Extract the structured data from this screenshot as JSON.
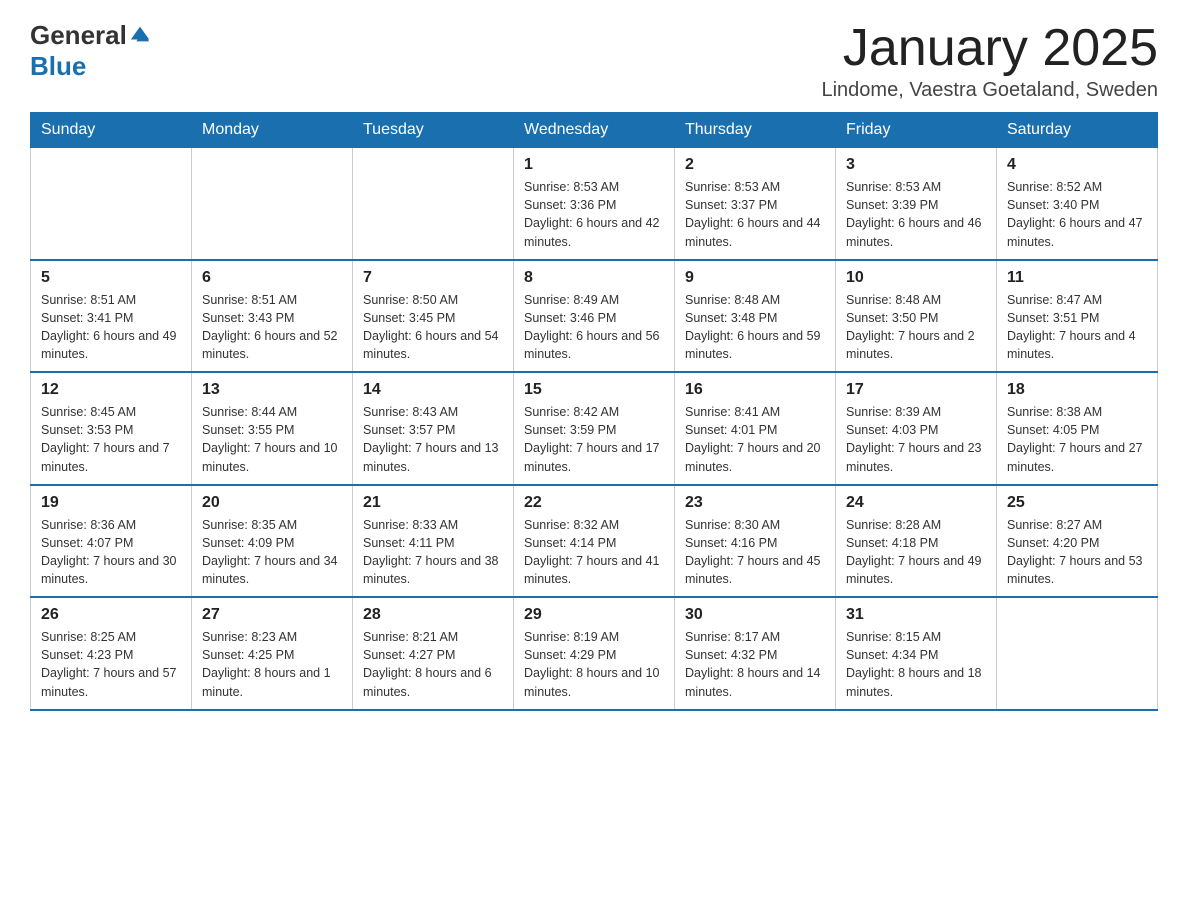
{
  "header": {
    "logo": {
      "general": "General",
      "blue": "Blue"
    },
    "title": "January 2025",
    "location": "Lindome, Vaestra Goetaland, Sweden"
  },
  "days_of_week": [
    "Sunday",
    "Monday",
    "Tuesday",
    "Wednesday",
    "Thursday",
    "Friday",
    "Saturday"
  ],
  "weeks": [
    [
      {
        "day": "",
        "info": ""
      },
      {
        "day": "",
        "info": ""
      },
      {
        "day": "",
        "info": ""
      },
      {
        "day": "1",
        "info": "Sunrise: 8:53 AM\nSunset: 3:36 PM\nDaylight: 6 hours and 42 minutes."
      },
      {
        "day": "2",
        "info": "Sunrise: 8:53 AM\nSunset: 3:37 PM\nDaylight: 6 hours and 44 minutes."
      },
      {
        "day": "3",
        "info": "Sunrise: 8:53 AM\nSunset: 3:39 PM\nDaylight: 6 hours and 46 minutes."
      },
      {
        "day": "4",
        "info": "Sunrise: 8:52 AM\nSunset: 3:40 PM\nDaylight: 6 hours and 47 minutes."
      }
    ],
    [
      {
        "day": "5",
        "info": "Sunrise: 8:51 AM\nSunset: 3:41 PM\nDaylight: 6 hours and 49 minutes."
      },
      {
        "day": "6",
        "info": "Sunrise: 8:51 AM\nSunset: 3:43 PM\nDaylight: 6 hours and 52 minutes."
      },
      {
        "day": "7",
        "info": "Sunrise: 8:50 AM\nSunset: 3:45 PM\nDaylight: 6 hours and 54 minutes."
      },
      {
        "day": "8",
        "info": "Sunrise: 8:49 AM\nSunset: 3:46 PM\nDaylight: 6 hours and 56 minutes."
      },
      {
        "day": "9",
        "info": "Sunrise: 8:48 AM\nSunset: 3:48 PM\nDaylight: 6 hours and 59 minutes."
      },
      {
        "day": "10",
        "info": "Sunrise: 8:48 AM\nSunset: 3:50 PM\nDaylight: 7 hours and 2 minutes."
      },
      {
        "day": "11",
        "info": "Sunrise: 8:47 AM\nSunset: 3:51 PM\nDaylight: 7 hours and 4 minutes."
      }
    ],
    [
      {
        "day": "12",
        "info": "Sunrise: 8:45 AM\nSunset: 3:53 PM\nDaylight: 7 hours and 7 minutes."
      },
      {
        "day": "13",
        "info": "Sunrise: 8:44 AM\nSunset: 3:55 PM\nDaylight: 7 hours and 10 minutes."
      },
      {
        "day": "14",
        "info": "Sunrise: 8:43 AM\nSunset: 3:57 PM\nDaylight: 7 hours and 13 minutes."
      },
      {
        "day": "15",
        "info": "Sunrise: 8:42 AM\nSunset: 3:59 PM\nDaylight: 7 hours and 17 minutes."
      },
      {
        "day": "16",
        "info": "Sunrise: 8:41 AM\nSunset: 4:01 PM\nDaylight: 7 hours and 20 minutes."
      },
      {
        "day": "17",
        "info": "Sunrise: 8:39 AM\nSunset: 4:03 PM\nDaylight: 7 hours and 23 minutes."
      },
      {
        "day": "18",
        "info": "Sunrise: 8:38 AM\nSunset: 4:05 PM\nDaylight: 7 hours and 27 minutes."
      }
    ],
    [
      {
        "day": "19",
        "info": "Sunrise: 8:36 AM\nSunset: 4:07 PM\nDaylight: 7 hours and 30 minutes."
      },
      {
        "day": "20",
        "info": "Sunrise: 8:35 AM\nSunset: 4:09 PM\nDaylight: 7 hours and 34 minutes."
      },
      {
        "day": "21",
        "info": "Sunrise: 8:33 AM\nSunset: 4:11 PM\nDaylight: 7 hours and 38 minutes."
      },
      {
        "day": "22",
        "info": "Sunrise: 8:32 AM\nSunset: 4:14 PM\nDaylight: 7 hours and 41 minutes."
      },
      {
        "day": "23",
        "info": "Sunrise: 8:30 AM\nSunset: 4:16 PM\nDaylight: 7 hours and 45 minutes."
      },
      {
        "day": "24",
        "info": "Sunrise: 8:28 AM\nSunset: 4:18 PM\nDaylight: 7 hours and 49 minutes."
      },
      {
        "day": "25",
        "info": "Sunrise: 8:27 AM\nSunset: 4:20 PM\nDaylight: 7 hours and 53 minutes."
      }
    ],
    [
      {
        "day": "26",
        "info": "Sunrise: 8:25 AM\nSunset: 4:23 PM\nDaylight: 7 hours and 57 minutes."
      },
      {
        "day": "27",
        "info": "Sunrise: 8:23 AM\nSunset: 4:25 PM\nDaylight: 8 hours and 1 minute."
      },
      {
        "day": "28",
        "info": "Sunrise: 8:21 AM\nSunset: 4:27 PM\nDaylight: 8 hours and 6 minutes."
      },
      {
        "day": "29",
        "info": "Sunrise: 8:19 AM\nSunset: 4:29 PM\nDaylight: 8 hours and 10 minutes."
      },
      {
        "day": "30",
        "info": "Sunrise: 8:17 AM\nSunset: 4:32 PM\nDaylight: 8 hours and 14 minutes."
      },
      {
        "day": "31",
        "info": "Sunrise: 8:15 AM\nSunset: 4:34 PM\nDaylight: 8 hours and 18 minutes."
      },
      {
        "day": "",
        "info": ""
      }
    ]
  ]
}
